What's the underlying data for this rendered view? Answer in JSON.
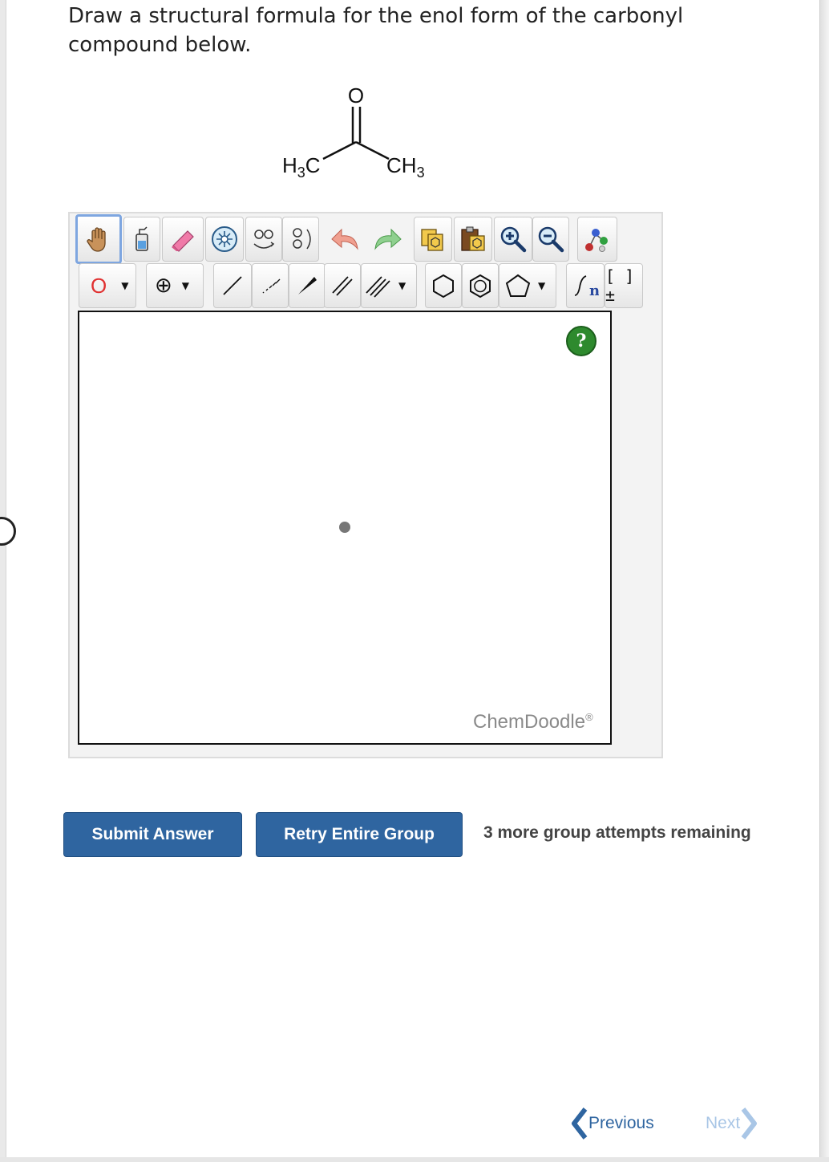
{
  "question": {
    "text": "Draw a structural formula for the enol form of the carbonyl compound below."
  },
  "molecule": {
    "oxygen": "O",
    "left_group": "H3C",
    "right_group": "CH3"
  },
  "toolbar": {
    "row1": [
      "hand-tool",
      "clear-tool",
      "eraser-tool",
      "center-tool",
      "flip-horizontal-tool",
      "flip-vertical-tool",
      "undo-tool",
      "redo-tool",
      "copy-tool",
      "paste-tool",
      "zoom-in-tool",
      "zoom-out-tool",
      "clean-tool"
    ],
    "row2": [
      "oxygen-atom-tool",
      "charge-tool",
      "single-bond-tool",
      "hashed-bond-tool",
      "wedge-bond-tool",
      "double-bond-tool",
      "triple-bond-tool",
      "hexagon-ring-tool",
      "benzene-ring-tool",
      "pentagon-ring-tool",
      "repeat-unit-tool",
      "bracket-charge-tool"
    ],
    "atom_label": "O",
    "charge_label": "⊕",
    "repeat_label": "n",
    "bracket_label": "[ ]±"
  },
  "canvas": {
    "help_label": "?",
    "brand": "ChemDoodle",
    "brand_mark": "®"
  },
  "actions": {
    "submit_label": "Submit Answer",
    "retry_label": "Retry Entire Group",
    "attempts_text": "3 more group attempts remaining"
  },
  "nav": {
    "previous_label": "Previous",
    "next_label": "Next"
  },
  "colors": {
    "button_blue": "#2f65a0",
    "nav_blue": "#2f65a0",
    "nav_disabled": "#a9c6e6",
    "help_green": "#2e8a2e",
    "atom_red": "#e03030"
  }
}
